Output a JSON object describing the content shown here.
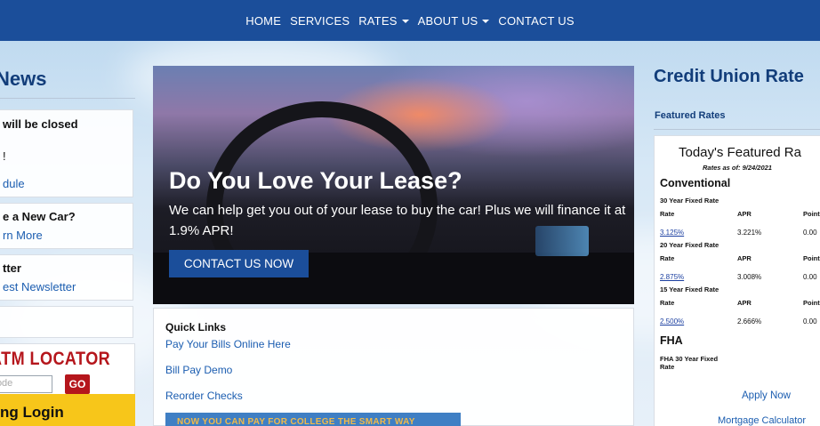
{
  "nav": {
    "items": [
      {
        "label": "HOME",
        "dropdown": false
      },
      {
        "label": "SERVICES",
        "dropdown": false
      },
      {
        "label": "RATES",
        "dropdown": true
      },
      {
        "label": "ABOUT US",
        "dropdown": true
      },
      {
        "label": "CONTACT US",
        "dropdown": false
      }
    ]
  },
  "left": {
    "title": "on News",
    "news": [
      {
        "line1": "will be closed",
        "line2": "!",
        "link": "dule"
      },
      {
        "line1": "e a New Car?",
        "link": "rn More"
      },
      {
        "line1": "tter",
        "link": "est Newsletter"
      }
    ],
    "atm": {
      "title": "ATM LOCATOR",
      "placeholder": "Code",
      "go_label": "GO"
    },
    "login_label": "ng Login"
  },
  "hero": {
    "title": "Do You Love Your Lease?",
    "body": "We can help get you out of your lease to buy the car! Plus we will finance it at 1.9% APR!",
    "button_label": "CONTACT US NOW"
  },
  "quick_links": {
    "title": "Quick Links",
    "links": [
      "Pay Your Bills Online Here",
      "Bill Pay Demo",
      "Reorder Checks"
    ],
    "banner_text": "NOW YOU CAN PAY FOR COLLEGE THE SMART WAY"
  },
  "rates": {
    "heading": "Credit Union Rate",
    "featured_label": "Featured Rates",
    "card_title": "Today's Featured Ra",
    "as_of": "Rates as of: 9/24/2021",
    "conventional_title": "Conventional",
    "columns": {
      "rate": "Rate",
      "apr": "APR",
      "points": "Point"
    },
    "groups": [
      {
        "name": "30 Year Fixed Rate",
        "rate": "3.125%",
        "apr": "3.221%",
        "points": "0.00"
      },
      {
        "name": "20 Year Fixed Rate",
        "rate": "2.875%",
        "apr": "3.008%",
        "points": "0.00"
      },
      {
        "name": "15 Year Fixed Rate",
        "rate": "2.500%",
        "apr": "2.666%",
        "points": "0.00"
      }
    ],
    "fha_title": "FHA",
    "fha_sub": "FHA 30 Year Fixed Rate",
    "apply_label": "Apply Now",
    "mortgage_label": "Mortgage Calculator"
  }
}
